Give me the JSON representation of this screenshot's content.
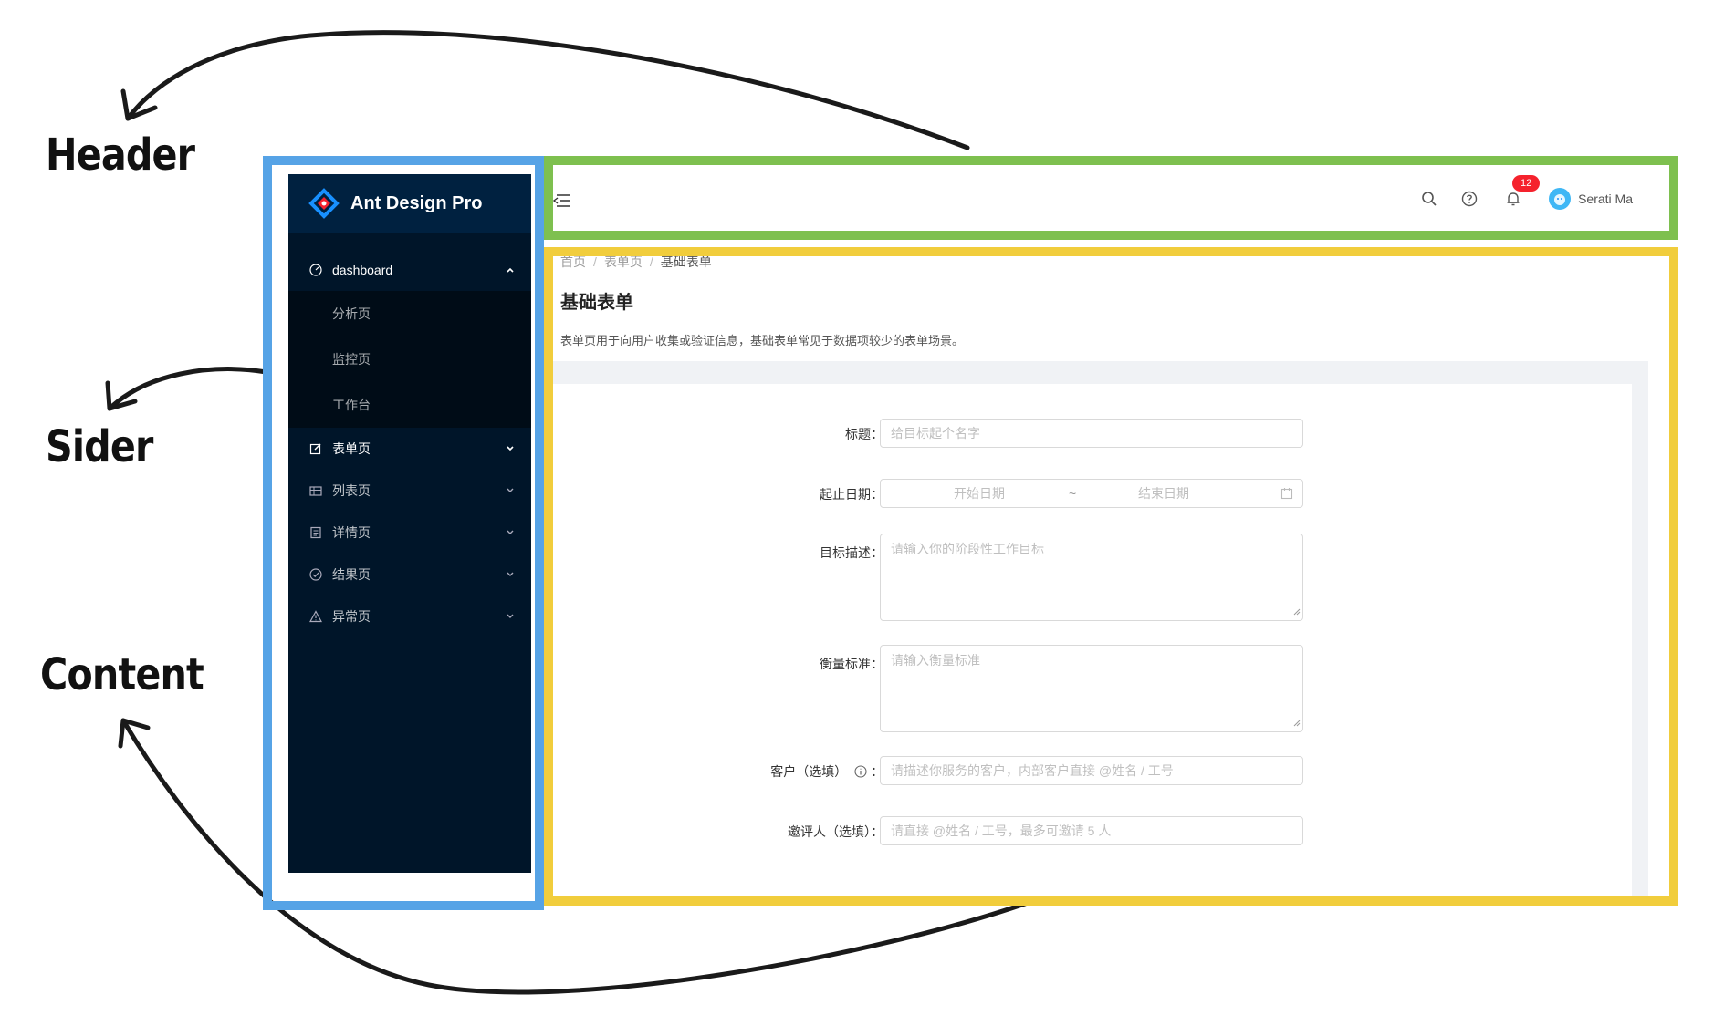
{
  "annotations": {
    "header_label": "Header",
    "sider_label": "Sider",
    "content_label": "Content",
    "colors": {
      "header": "#7ec04f",
      "sider": "#56a3e6",
      "content": "#f1cd3c"
    }
  },
  "sider": {
    "logo_text": "Ant Design Pro",
    "menu": [
      {
        "label": "dashboard",
        "icon": "dashboard-icon",
        "expanded": true,
        "children": [
          "分析页",
          "监控页",
          "工作台"
        ]
      },
      {
        "label": "表单页",
        "icon": "form-icon",
        "expanded": false
      },
      {
        "label": "列表页",
        "icon": "table-icon",
        "expanded": false
      },
      {
        "label": "详情页",
        "icon": "profile-icon",
        "expanded": false
      },
      {
        "label": "结果页",
        "icon": "check-circle-icon",
        "expanded": false
      },
      {
        "label": "异常页",
        "icon": "warning-icon",
        "expanded": false
      }
    ]
  },
  "header": {
    "notification_count": "12",
    "user_name": "Serati Ma"
  },
  "content": {
    "breadcrumb": [
      "首页",
      "表单页",
      "基础表单"
    ],
    "title": "基础表单",
    "description": "表单页用于向用户收集或验证信息，基础表单常见于数据项较少的表单场景。",
    "form": {
      "title_label": "标题：",
      "title_placeholder": "给目标起个名字",
      "date_label": "起止日期：",
      "date_start_placeholder": "开始日期",
      "date_sep": "~",
      "date_end_placeholder": "结束日期",
      "goal_label": "目标描述：",
      "goal_placeholder": "请输入你的阶段性工作目标",
      "standard_label": "衡量标准：",
      "standard_placeholder": "请输入衡量标准",
      "client_label": "客户（选填）",
      "client_placeholder": "请描述你服务的客户，内部客户直接 @姓名 / 工号",
      "invitee_label": "邀评人（选填）：",
      "invitee_placeholder": "请直接 @姓名 / 工号，最多可邀请 5 人"
    }
  }
}
